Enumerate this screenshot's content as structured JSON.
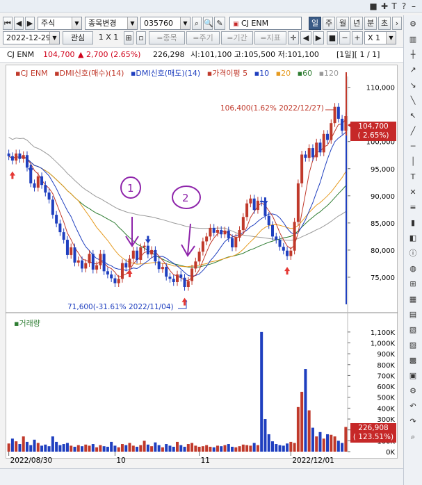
{
  "toolbar": {
    "product_type": "주식",
    "code_change_label": "종목변경",
    "code_value": "035760",
    "stock_name_box": "CJ ENM",
    "period_tabs": [
      "일",
      "주",
      "월",
      "년",
      "분",
      "초"
    ],
    "date_value": "2022-12-29",
    "watch_label": "관심",
    "zoom_label": "1 X 1",
    "tool_labels": [
      "=종목",
      "=주기",
      "=기간",
      "=지표"
    ],
    "scale_value": "X 1"
  },
  "info": {
    "name": "CJ ENM",
    "price": "104,700",
    "change": "▲ 2,700 (2.65%)",
    "volume": "226,298",
    "open_high_low": "시:101,100 고:105,500 저:101,100",
    "page": "[1일][ 1 / 1]"
  },
  "legend": {
    "items": [
      {
        "text": "CJ ENM",
        "color": "#c0392b"
      },
      {
        "text": "DMI신호(매수)(14)",
        "color": "#c0392b"
      },
      {
        "text": "DMI신호(매도)(14)",
        "color": "#1f3fbf"
      },
      {
        "text": "가격이평 5",
        "color": "#c0392b"
      },
      {
        "text": "10",
        "color": "#1f3fbf"
      },
      {
        "text": "20",
        "color": "#e69a1f"
      },
      {
        "text": "60",
        "color": "#2e7d32"
      },
      {
        "text": "120",
        "color": "#999999"
      }
    ],
    "volume_label": "거래량"
  },
  "price_box": {
    "price": "104,700",
    "pct": "( 2.65%)"
  },
  "volume_box": {
    "value": "226,908",
    "pct": "( 123.51%)"
  },
  "annotations": {
    "high": "106,400(1.62% 2022/12/27)",
    "low": "71,600(-31.61% 2022/11/04)",
    "marker1": "1",
    "marker2": "2"
  },
  "chart_data": {
    "type": "candlestick",
    "price_axis_ticks": [
      75000,
      80000,
      85000,
      90000,
      95000,
      100000,
      110000
    ],
    "price_axis_labels": [
      "75,000",
      "80,000",
      "85,000",
      "90,000",
      "95,000",
      "100,000",
      "110,000"
    ],
    "volume_axis_labels": [
      "1,100K",
      "1,000K",
      "900K",
      "800K",
      "700K",
      "600K",
      "500K",
      "400K",
      "300K",
      "200K",
      "100K",
      "0K"
    ],
    "x_labels": [
      "2022/08/30",
      "10",
      "11",
      "2022/12/01"
    ],
    "ylim": [
      70000,
      112000
    ],
    "volume_ylim": [
      0,
      1150
    ],
    "closes": [
      97300,
      96500,
      97800,
      96800,
      97500,
      95200,
      92300,
      91500,
      93600,
      92000,
      90600,
      89300,
      86500,
      84900,
      83300,
      81900,
      79100,
      80500,
      77700,
      78100,
      76600,
      77600,
      79300,
      76400,
      77200,
      79300,
      76100,
      75500,
      74800,
      73900,
      74700,
      77600,
      76800,
      78400,
      79900,
      78200,
      80500,
      80800,
      79200,
      80000,
      77900,
      76500,
      76900,
      75100,
      74700,
      74100,
      75500,
      74900,
      73200,
      74300,
      76600,
      77900,
      79700,
      81600,
      82500,
      84100,
      83200,
      83700,
      82900,
      83600,
      82200,
      80500,
      82300,
      83700,
      86100,
      88600,
      89500,
      87400,
      89100,
      88800,
      86300,
      84600,
      82500,
      81900,
      80600,
      79900,
      78900,
      79900,
      85200,
      92300,
      97600,
      97000,
      98800,
      97100,
      99800,
      98000,
      101400,
      100300,
      103400,
      106400,
      104200,
      102000,
      104700
    ],
    "volumes": [
      75,
      120,
      95,
      70,
      140,
      90,
      60,
      110,
      80,
      55,
      65,
      50,
      140,
      90,
      60,
      70,
      80,
      55,
      45,
      60,
      50,
      65,
      55,
      70,
      40,
      60,
      50,
      45,
      90,
      55,
      40,
      70,
      60,
      80,
      55,
      45,
      60,
      100,
      65,
      50,
      85,
      60,
      40,
      70,
      55,
      45,
      90,
      60,
      45,
      70,
      80,
      55,
      45,
      50,
      60,
      45,
      40,
      55,
      50,
      60,
      70,
      45,
      40,
      50,
      65,
      60,
      55,
      80,
      60,
      1100,
      300,
      160,
      95,
      70,
      60,
      55,
      75,
      90,
      80,
      410,
      550,
      760,
      380,
      220,
      140,
      180,
      120,
      160,
      155,
      140,
      100,
      80,
      227
    ]
  }
}
